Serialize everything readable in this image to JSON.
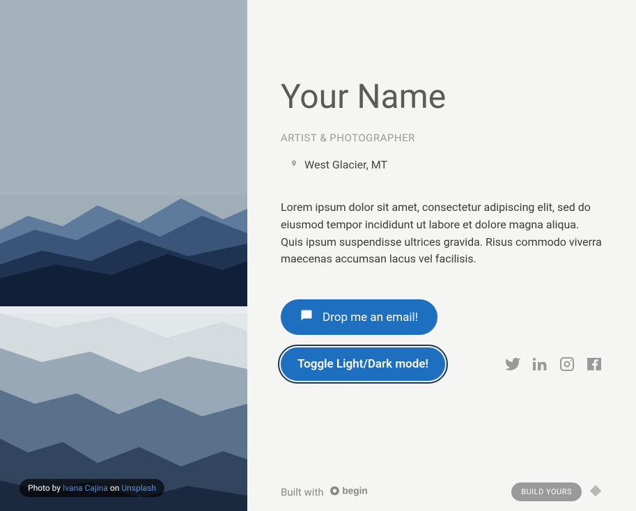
{
  "profile": {
    "name": "Your Name",
    "subtitle": "ARTIST & PHOTOGRAPHER",
    "location": "West Glacier, MT",
    "bio": "Lorem ipsum dolor sit amet, consectetur adipiscing elit, sed do eiusmod tempor incididunt ut labore et dolore magna aliqua. Quis ipsum suspendisse ultrices gravida. Risus commodo viverra maecenas accumsan lacus vel facilisis."
  },
  "buttons": {
    "email": "Drop me an email!",
    "toggle": "Toggle Light/Dark mode!"
  },
  "credit": {
    "prefix": "Photo by ",
    "author": "Ivana Cajina",
    "middle": " on ",
    "source": "Unsplash"
  },
  "footer": {
    "built_with": "Built with",
    "brand": "begin",
    "build_yours": "BUILD YOURS"
  }
}
